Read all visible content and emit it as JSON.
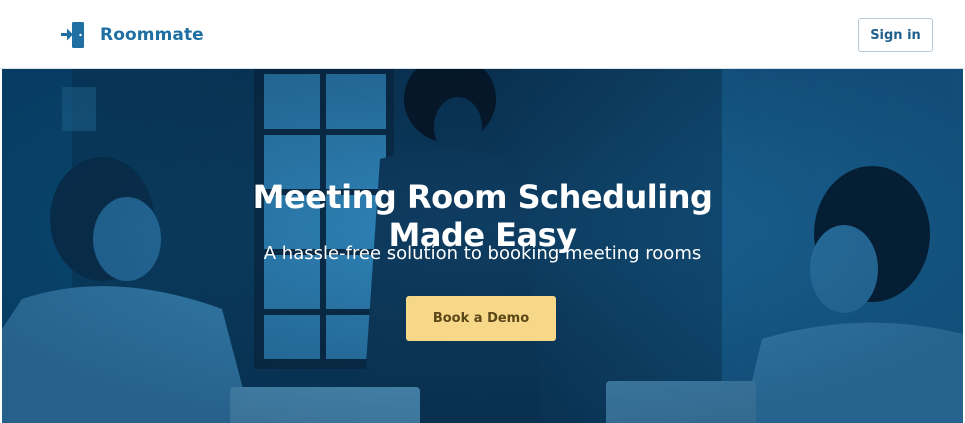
{
  "header": {
    "brand_name": "Roommate",
    "sign_in_label": "Sign in"
  },
  "hero": {
    "title_line1": "Meeting Room Scheduling",
    "title_line2": "Made Easy",
    "subtitle": "A hassle-free solution to booking meeting rooms",
    "cta_label": "Book a Demo"
  },
  "icons": {
    "logo": "door-enter-icon"
  },
  "colors": {
    "brand": "#1f6fa3",
    "hero_tint": "#0d4f7c",
    "cta_background": "#f7d888",
    "cta_text": "#5a4617"
  }
}
